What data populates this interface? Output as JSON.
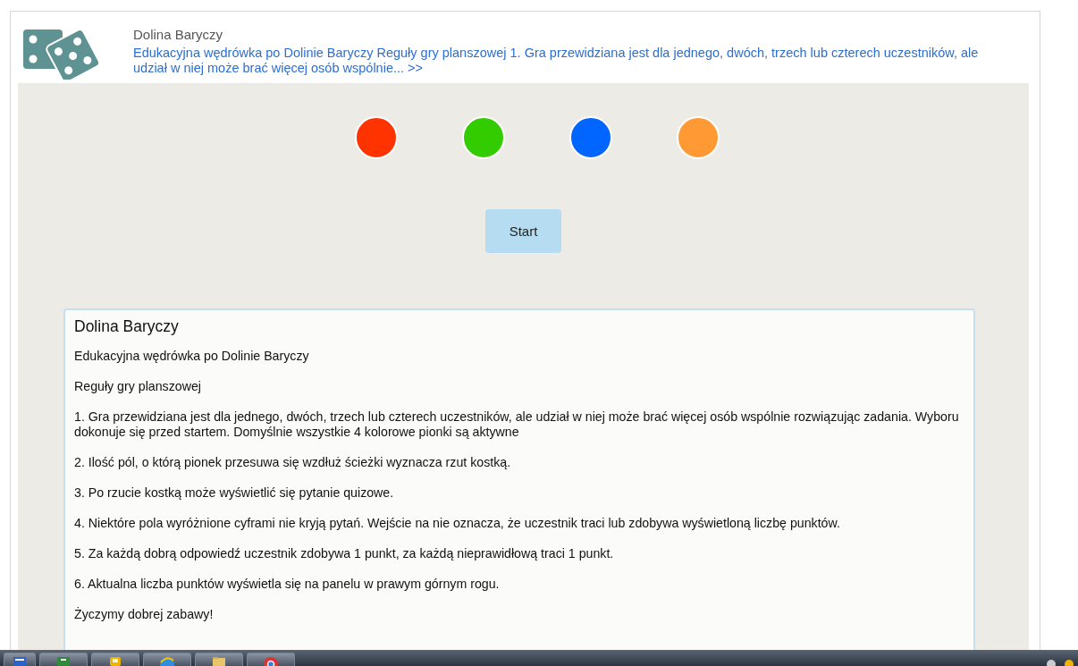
{
  "header": {
    "title": "Dolina Baryczy",
    "summary_link": "Edukacyjna wędrówka po Dolinie Baryczy Reguły gry planszowej 1. Gra przewidziana jest dla jednego, dwóch, trzech lub czterech uczestników, ale udział w niej może brać więcej osób wspólnie... >>"
  },
  "players": [
    {
      "color": "#ff3300"
    },
    {
      "color": "#33cc00"
    },
    {
      "color": "#0066ff"
    },
    {
      "color": "#ff9933"
    }
  ],
  "start_button": "Start",
  "rules": {
    "title": "Dolina Baryczy",
    "paragraphs": [
      "Edukacyjna wędrówka po Dolinie Baryczy",
      "Reguły gry planszowej",
      "1. Gra przewidziana jest dla jednego, dwóch, trzech lub czterech uczestników, ale udział w niej może brać więcej osób wspólnie rozwiązując zadania. Wyboru dokonuje się przed startem. Domyślnie wszystkie 4 kolorowe pionki są aktywne",
      "2. Ilość pól, o którą pionek przesuwa się wzdłuż ścieżki wyznacza rzut kostką.",
      "3. Po rzucie kostką może wyświetlić się pytanie quizowe.",
      "4. Niektóre pola wyróżnione cyframi nie kryją pytań. Wejście na nie oznacza, że uczestnik traci lub zdobywa wyświetloną liczbę punktów.",
      "5. Za każdą dobrą odpowiedź uczestnik zdobywa 1 punkt, za każdą nieprawidłową traci 1 punkt.",
      "6. Aktualna liczba punktów wyświetla się na panelu w prawym górnym rogu.",
      "Życzymy dobrej zabawy!"
    ]
  },
  "taskbar": {
    "apps": [
      {
        "kind": "document"
      },
      {
        "kind": "spreadsheet"
      },
      {
        "kind": "note"
      },
      {
        "kind": "browser"
      },
      {
        "kind": "folder"
      },
      {
        "kind": "round"
      }
    ]
  }
}
